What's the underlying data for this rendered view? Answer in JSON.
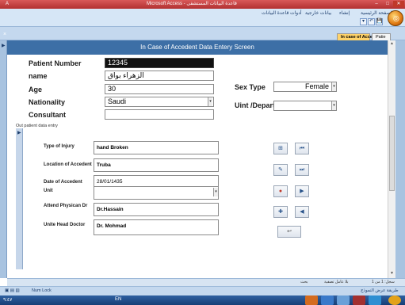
{
  "window": {
    "title": "Microsoft Access - قاعدة البيانات المستشفى",
    "controls": [
      "–",
      "□",
      "✕"
    ]
  },
  "ribbon": {
    "tabs": [
      "الصفحة الرئيسية",
      "إنشاء",
      "بيانات خارجية",
      "أدوات قاعدة البيانات"
    ],
    "quick_access": [
      "▾",
      "↶",
      "💾"
    ]
  },
  "doc_tabs": {
    "active": "In case of Accedent",
    "other": "Patie"
  },
  "form": {
    "header": "In Case of Accedent Data Entery Screen",
    "labels": {
      "patient_number": "Patient Number",
      "name": "name",
      "age": "Age",
      "nationality": "Nationality",
      "consultant": "Consultant",
      "sex_type": "Sex Type",
      "unit_department": "Uint /Departn"
    },
    "values": {
      "patient_number": "12345",
      "name": "الزهراء بواق",
      "age": "30",
      "nationality": "Saudi",
      "consultant": "",
      "sex_type": "Female",
      "unit_department": ""
    }
  },
  "subform": {
    "caption": "Out patient data entry",
    "labels": {
      "type_of_injury": "Type of Injury",
      "location_of_accedent": "Location of Accedent",
      "date_of_accedent": "Date of Accedent",
      "unit": "Unit",
      "attend_physician": "Attend Physican Dr",
      "unite_head_doctor": "Unite Head Doctor"
    },
    "values": {
      "type_of_injury": "hand Broken",
      "location_of_accedent": "Truba",
      "date_of_accedent": "28/01/1435",
      "unit": "",
      "attend_physician": "Dr.Hassain",
      "unite_head_doctor": "Dr. Mohmad"
    },
    "buttons": [
      "⊞",
      "⏮",
      "✎",
      "⏭",
      "●",
      "▶",
      "✚",
      "◀",
      "↩"
    ]
  },
  "record_nav": {
    "record_text": "سجل: 1 من 1",
    "filter_text": "بلا عامل تصفية",
    "search_text": "بحث"
  },
  "status_bar": {
    "left": "Num Lock",
    "right": "طريقة عرض النموذج"
  },
  "taskbar": {
    "language": "EN",
    "time": "٩:٤٧"
  }
}
